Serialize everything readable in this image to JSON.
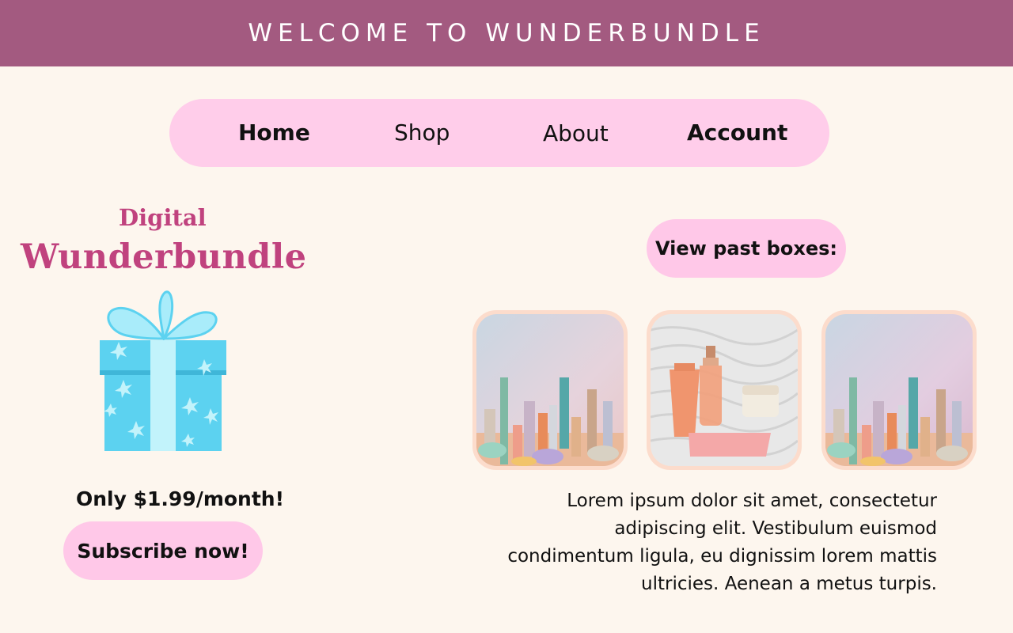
{
  "banner": {
    "title": "WELCOME TO WUNDERBUNDLE"
  },
  "nav": {
    "items": [
      {
        "label": "Home",
        "bold": true
      },
      {
        "label": "Shop",
        "bold": false
      },
      {
        "label": "About",
        "bold": false
      },
      {
        "label": "Account",
        "bold": true
      }
    ]
  },
  "brand": {
    "subtitle": "Digital",
    "title": "Wunderbundle"
  },
  "pricing": {
    "price_text": "Only $1.99/month!",
    "subscribe_label": "Subscribe now!"
  },
  "past_boxes": {
    "button_label": "View past boxes:"
  },
  "description": "Lorem ipsum dolor sit amet, consectetur adipiscing elit. Vestibulum euismod condimentum ligula, eu dignissim lorem mattis ultricies. Aenean a metus turpis.",
  "colors": {
    "banner": "#a35a80",
    "nav_pill": "#ffcdea",
    "brand_text": "#c0427e",
    "button_pill": "#ffc8e8",
    "background": "#fdf6ee",
    "gift_box": "#5cd2f0",
    "gift_ribbon": "#c2f3fb"
  },
  "icons": {
    "gift": "gift-box-icon"
  }
}
